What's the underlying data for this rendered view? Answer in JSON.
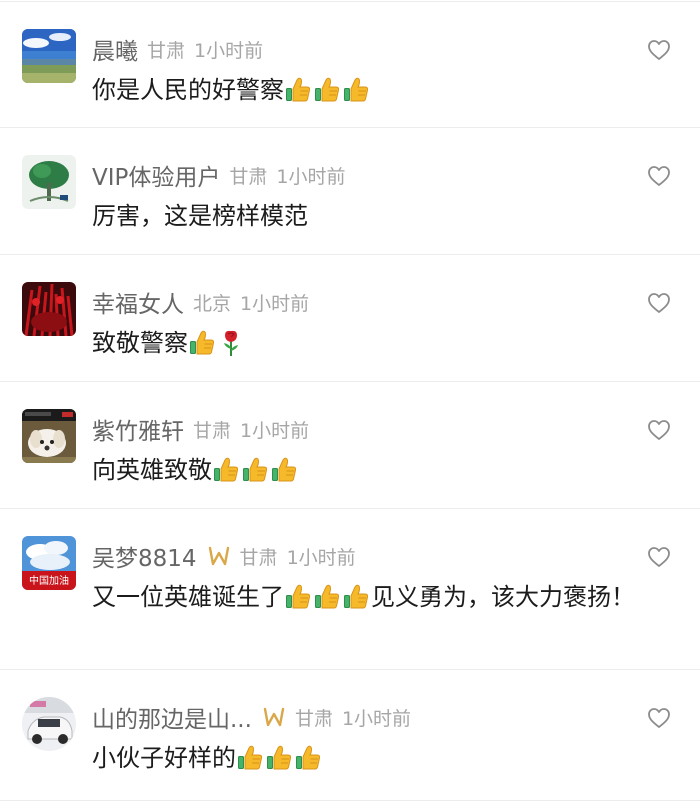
{
  "colors": {
    "username": "#666666",
    "meta": "#a6a6a6",
    "text": "#1c1c1c",
    "divider": "#ececec",
    "badge": "#d9a84a"
  },
  "comments": [
    {
      "username": "晨曦",
      "location": "甘肃",
      "time": "1小时前",
      "text": "你是人民的好警察",
      "emojis": [
        "thumbs-up",
        "thumbs-up",
        "thumbs-up"
      ],
      "has_badge": false
    },
    {
      "username": "VIP体验用户",
      "location": "甘肃",
      "time": "1小时前",
      "text": "厉害，这是榜样模范",
      "emojis": [],
      "has_badge": false
    },
    {
      "username": "幸福女人",
      "location": "北京",
      "time": "1小时前",
      "text": "致敬警察",
      "emojis": [
        "thumbs-up",
        "rose"
      ],
      "has_badge": false
    },
    {
      "username": "紫竹雅轩",
      "location": "甘肃",
      "time": "1小时前",
      "text": "向英雄致敬",
      "emojis": [
        "thumbs-up",
        "thumbs-up",
        "thumbs-up"
      ],
      "has_badge": false
    },
    {
      "username": "吴梦8814",
      "location": "甘肃",
      "time": "1小时前",
      "text_before": "又一位英雄诞生了",
      "emojis": [
        "thumbs-up",
        "thumbs-up",
        "thumbs-up"
      ],
      "text_after": "见义勇为，该大力褒扬！",
      "avatar_text": "中国加油",
      "has_badge": true
    },
    {
      "username": "山的那边是山...",
      "location": "甘肃",
      "time": "1小时前",
      "text": "小伙子好样的",
      "emojis": [
        "thumbs-up",
        "thumbs-up",
        "thumbs-up"
      ],
      "has_badge": true
    }
  ],
  "icons": {
    "like": "heart-outline-icon",
    "badge": "infinity-badge-icon",
    "thumbs": "thumbs-up-emoji",
    "rose": "rose-emoji"
  }
}
